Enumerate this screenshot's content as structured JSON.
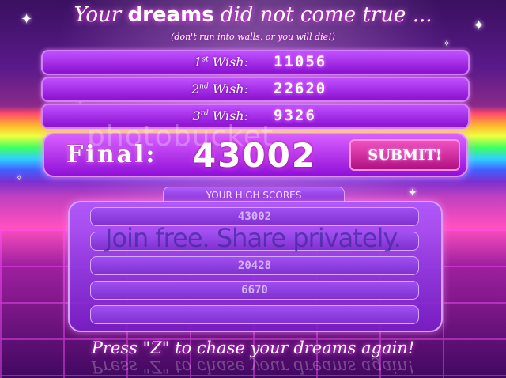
{
  "title": {
    "prefix": "Your ",
    "bold": "dreams",
    "suffix": " did not come true ..."
  },
  "subtitle": "(don't run into walls, or you will die!)",
  "wishes": [
    {
      "ordinal": "1",
      "ordinal_suffix": "st",
      "label": " Wish:",
      "value": "11056"
    },
    {
      "ordinal": "2",
      "ordinal_suffix": "nd",
      "label": " Wish:",
      "value": "22620"
    },
    {
      "ordinal": "3",
      "ordinal_suffix": "rd",
      "label": " Wish:",
      "value": "9326"
    }
  ],
  "final": {
    "label": "Final:",
    "value": "43002",
    "submit_label": "SUBMIT!"
  },
  "high_scores": {
    "title": "YOUR HIGH SCORES",
    "scores": [
      "43002",
      "",
      "20428",
      "6670",
      ""
    ]
  },
  "watermark": {
    "logo": "photobucket",
    "tagline": "Join free. Share privately."
  },
  "footer": "Press \"Z\" to chase your dreams again!",
  "colors": {
    "panel": "#a040f0",
    "submit": "#d02090",
    "text": "#ffffff"
  }
}
